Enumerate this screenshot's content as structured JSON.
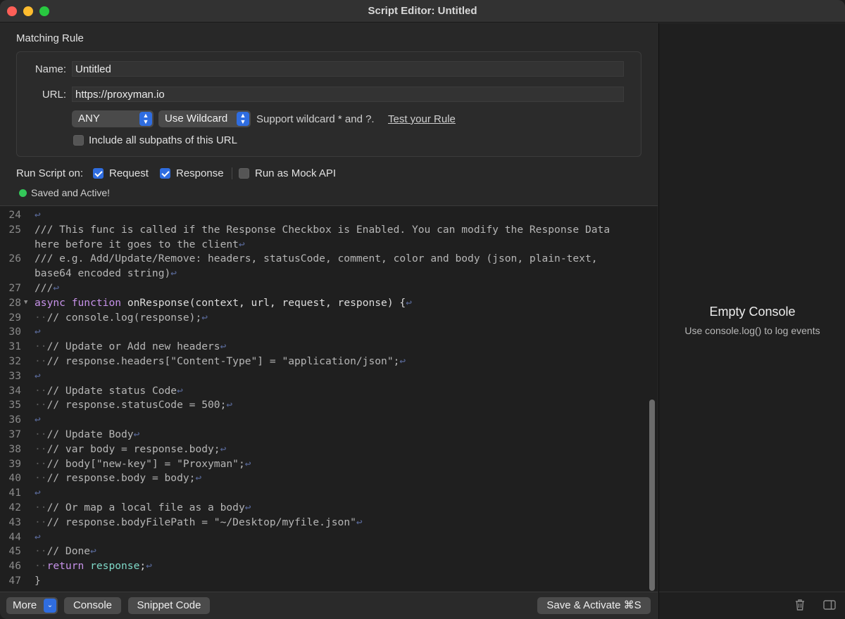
{
  "window": {
    "title": "Script Editor: Untitled"
  },
  "rule": {
    "section_title": "Matching Rule",
    "name_label": "Name:",
    "name_value": "Untitled",
    "url_label": "URL:",
    "url_value": "https://proxyman.io",
    "method_value": "ANY",
    "match_type_value": "Use Wildcard",
    "wildcard_hint": "Support wildcard * and ?.",
    "test_link": "Test your Rule",
    "subpaths_label": "Include all subpaths of this URL",
    "subpaths_checked": false
  },
  "run_script": {
    "label": "Run Script on:",
    "request_label": "Request",
    "request_checked": true,
    "response_label": "Response",
    "response_checked": true,
    "mock_label": "Run as Mock API",
    "mock_checked": false
  },
  "status": {
    "text": "Saved and Active!",
    "color": "#34c759"
  },
  "code_lines": [
    {
      "n": "24",
      "text": ""
    },
    {
      "n": "25",
      "text": "/// This func is called if the Response Checkbox is Enabled. You can modify the Response Data"
    },
    {
      "n": "",
      "text": "here before it goes to the client"
    },
    {
      "n": "26",
      "text": "/// e.g. Add/Update/Remove: headers, statusCode, comment, color and body (json, plain-text,"
    },
    {
      "n": "",
      "text": "base64 encoded string)"
    },
    {
      "n": "27",
      "text": "///"
    },
    {
      "n": "28",
      "text": "async function onResponse(context, url, request, response) {"
    },
    {
      "n": "29",
      "text": "  // console.log(response);"
    },
    {
      "n": "30",
      "text": ""
    },
    {
      "n": "31",
      "text": "  // Update or Add new headers"
    },
    {
      "n": "32",
      "text": "  // response.headers[\"Content-Type\"] = \"application/json\";"
    },
    {
      "n": "33",
      "text": ""
    },
    {
      "n": "34",
      "text": "  // Update status Code"
    },
    {
      "n": "35",
      "text": "  // response.statusCode = 500;"
    },
    {
      "n": "36",
      "text": ""
    },
    {
      "n": "37",
      "text": "  // Update Body"
    },
    {
      "n": "38",
      "text": "  // var body = response.body;"
    },
    {
      "n": "39",
      "text": "  // body[\"new-key\"] = \"Proxyman\";"
    },
    {
      "n": "40",
      "text": "  // response.body = body;"
    },
    {
      "n": "41",
      "text": ""
    },
    {
      "n": "42",
      "text": "  // Or map a local file as a body"
    },
    {
      "n": "43",
      "text": "  // response.bodyFilePath = \"~/Desktop/myfile.json\""
    },
    {
      "n": "44",
      "text": ""
    },
    {
      "n": "45",
      "text": "  // Done"
    },
    {
      "n": "46",
      "text": "  return response;"
    },
    {
      "n": "47",
      "text": "}"
    }
  ],
  "bottom_bar": {
    "more_label": "More",
    "console_label": "Console",
    "snippet_label": "Snippet Code",
    "save_label": "Save & Activate ⌘S"
  },
  "console": {
    "title": "Empty Console",
    "subtitle": "Use console.log() to log events"
  },
  "icons": {
    "trash": "trash-icon",
    "sidebar": "sidebar-toggle-icon"
  },
  "colors": {
    "accent": "#2f6de0",
    "keyword": "#c792ea",
    "identifier": "#7fd9c8"
  }
}
